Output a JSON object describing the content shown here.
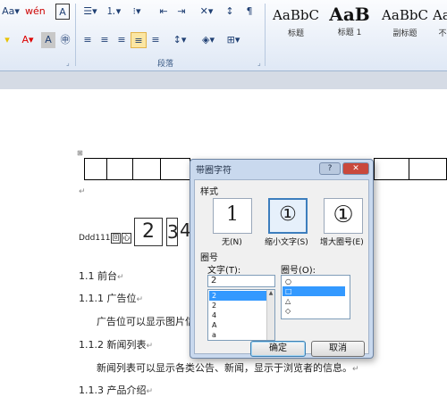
{
  "ribbon": {
    "row1": [
      {
        "name": "change-case-button",
        "text": "Aa▾"
      },
      {
        "name": "phonetic-guide-button",
        "text": "wén"
      },
      {
        "name": "character-border-button",
        "text": "A"
      },
      {
        "name": "bullets-button",
        "text": "☰▾"
      },
      {
        "name": "numbering-button",
        "text": "⒈▾"
      },
      {
        "name": "multilevel-list-button",
        "text": "⁝▾"
      },
      {
        "name": "decrease-indent-button",
        "text": "⇤"
      },
      {
        "name": "increase-indent-button",
        "text": "⇥"
      },
      {
        "name": "chinese-layout-button",
        "text": "✕▾"
      },
      {
        "name": "sort-button",
        "text": "↕"
      },
      {
        "name": "show-marks-button",
        "text": "¶"
      }
    ],
    "row2": [
      {
        "name": "text-highlight-button",
        "text": "▾"
      },
      {
        "name": "font-color-button",
        "text": "A▾"
      },
      {
        "name": "character-shading-button",
        "text": "A"
      },
      {
        "name": "enclose-characters-button",
        "text": "㊥"
      },
      {
        "name": "align-left-button",
        "text": "≡"
      },
      {
        "name": "center-button",
        "text": "≡"
      },
      {
        "name": "align-right-button",
        "text": "≡"
      },
      {
        "name": "justify-button",
        "text": "≡"
      },
      {
        "name": "distributed-button",
        "text": "≡"
      },
      {
        "name": "line-spacing-button",
        "text": "↕▾"
      },
      {
        "name": "shading-button",
        "text": "◈▾"
      },
      {
        "name": "borders-button",
        "text": "⊞▾"
      }
    ],
    "paragraph_group_label": "段落",
    "styles": [
      {
        "sample": "AaBbC",
        "name": "标题"
      },
      {
        "sample": "AaB",
        "name": "标题 1"
      },
      {
        "sample": "AaBbC",
        "name": "副标题"
      },
      {
        "sample": "AaBbC",
        "name": "不明显"
      }
    ]
  },
  "document": {
    "ddd_prefix": "Ddd111",
    "small_box_1": "回",
    "small_box_2": "心",
    "big_box_1": "2",
    "big_box_2": "3",
    "big_char": "4",
    "lines": [
      {
        "text": "1.1 前台"
      },
      {
        "text": "1.1.1 广告位"
      },
      {
        "text": "广告位可以显示图片信"
      },
      {
        "text": "1.1.2 新闻列表"
      },
      {
        "text": "新闻列表可以显示各类公告、新闻，显示于浏览者的信息。"
      },
      {
        "text": "1.1.3 产品介绍"
      }
    ],
    "para_mark": "↵"
  },
  "dialog": {
    "title": "带圈字符",
    "help": "?",
    "close": "✕",
    "style_label": "样式",
    "options": [
      {
        "glyph": "1",
        "caption": "无(N)"
      },
      {
        "glyph": "①",
        "caption": "缩小文字(S)"
      },
      {
        "glyph": "①",
        "caption": "增大圈号(E)"
      }
    ],
    "enclosure_label": "圈号",
    "text_label": "文字(T):",
    "text_value": "2",
    "text_items": [
      "2",
      "2",
      "4",
      "A",
      "a"
    ],
    "enclosure_list_label": "圈号(O):",
    "enclosure_items": [
      "○",
      "□",
      "△",
      "◇"
    ],
    "ok": "确定",
    "cancel": "取消"
  },
  "colors": {
    "ribbon_top": "#fbfcfe",
    "ribbon_bottom": "#dfe8f5",
    "dialog_frame": "#c9d9ee",
    "selection": "#3399ff"
  }
}
